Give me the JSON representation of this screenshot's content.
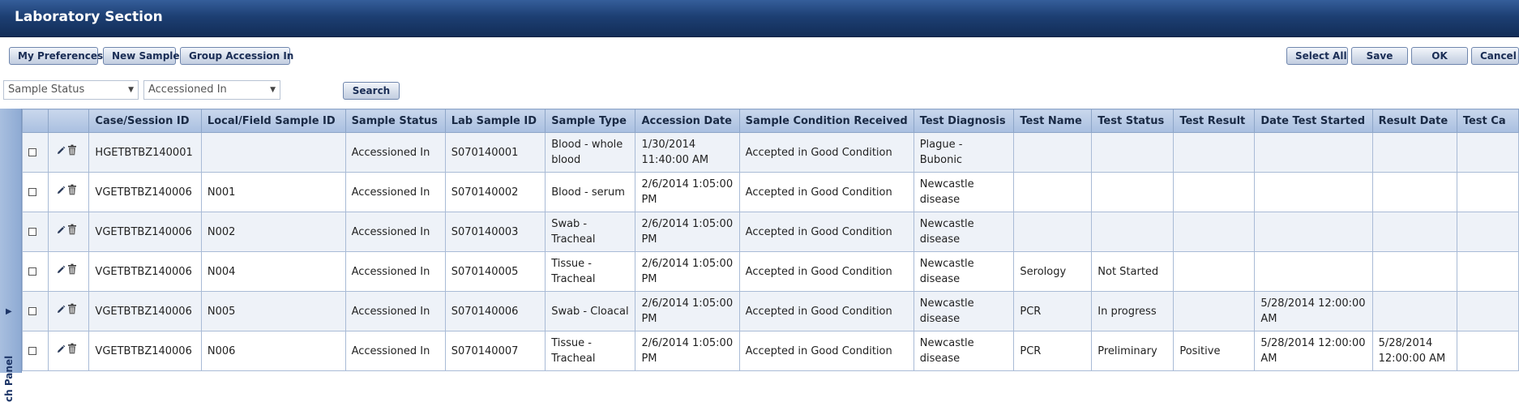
{
  "header": {
    "title": "Laboratory Section"
  },
  "toolbar": {
    "my_preferences": "My Preferences",
    "new_sample": "New Sample",
    "group_accession": "Group Accession In",
    "select_all": "Select All",
    "save": "Save",
    "ok": "OK",
    "cancel": "Cancel"
  },
  "filters": {
    "status_placeholder": "Sample Status",
    "accession_value": "Accessioned In",
    "search": "Search"
  },
  "side_panel": {
    "label": "ch Panel"
  },
  "grid": {
    "columns": [
      "Case/Session ID",
      "Local/Field Sample ID",
      "Sample Status",
      "Lab Sample ID",
      "Sample Type",
      "Accession Date",
      "Sample Condition Received",
      "Test Diagnosis",
      "Test Name",
      "Test Status",
      "Test Result",
      "Date Test Started",
      "Result Date",
      "Test Ca"
    ],
    "rows": [
      [
        "HGETBTBZ140001",
        "",
        "Accessioned In",
        "S070140001",
        "Blood - whole blood",
        "1/30/2014 11:40:00 AM",
        "Accepted in Good Condition",
        "Plague - Bubonic",
        "",
        "",
        "",
        "",
        ""
      ],
      [
        "VGETBTBZ140006",
        "N001",
        "Accessioned In",
        "S070140002",
        "Blood - serum",
        "2/6/2014 1:05:00 PM",
        "Accepted in Good Condition",
        "Newcastle disease",
        "",
        "",
        "",
        "",
        ""
      ],
      [
        "VGETBTBZ140006",
        "N002",
        "Accessioned In",
        "S070140003",
        "Swab - Tracheal",
        "2/6/2014 1:05:00 PM",
        "Accepted in Good Condition",
        "Newcastle disease",
        "",
        "",
        "",
        "",
        ""
      ],
      [
        "VGETBTBZ140006",
        "N004",
        "Accessioned In",
        "S070140005",
        "Tissue - Tracheal",
        "2/6/2014 1:05:00 PM",
        "Accepted in Good Condition",
        "Newcastle disease",
        "Serology",
        "Not Started",
        "",
        "",
        ""
      ],
      [
        "VGETBTBZ140006",
        "N005",
        "Accessioned In",
        "S070140006",
        "Swab - Cloacal",
        "2/6/2014 1:05:00 PM",
        "Accepted in Good Condition",
        "Newcastle disease",
        "PCR",
        "In progress",
        "",
        "5/28/2014 12:00:00 AM",
        ""
      ],
      [
        "VGETBTBZ140006",
        "N006",
        "Accessioned In",
        "S070140007",
        "Tissue - Tracheal",
        "2/6/2014 1:05:00 PM",
        "Accepted in Good Condition",
        "Newcastle disease",
        "PCR",
        "Preliminary",
        "Positive",
        "5/28/2014 12:00:00 AM",
        "5/28/2014 12:00:00 AM"
      ]
    ]
  }
}
